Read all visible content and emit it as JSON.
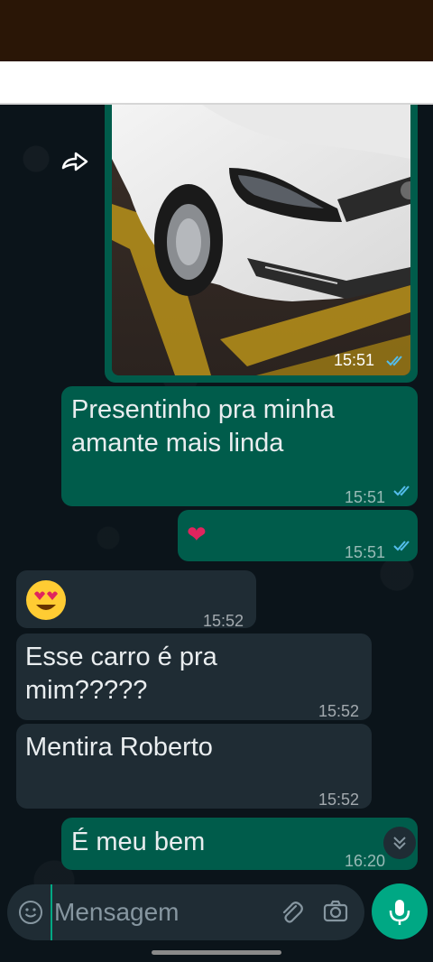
{
  "messages": [
    {
      "type": "image",
      "time": "15:51",
      "status": "read",
      "image": "white-car-photo"
    },
    {
      "type": "text",
      "direction": "out",
      "text_line1": "Presentinho pra minha",
      "text_line2": "amante mais linda",
      "time": "15:51",
      "status": "read"
    },
    {
      "type": "emoji",
      "direction": "out",
      "emoji": "❤️",
      "time": "15:51",
      "status": "read"
    },
    {
      "type": "emoji",
      "direction": "in",
      "emoji": "😍",
      "time": "15:52"
    },
    {
      "type": "text",
      "direction": "in",
      "text_line1": "Esse carro é pra",
      "text_line2": "mim?????",
      "time": "15:52"
    },
    {
      "type": "text",
      "direction": "in",
      "text_line1": "Mentira Roberto",
      "time": "15:52"
    },
    {
      "type": "text",
      "direction": "out",
      "text_line1": "É meu bem",
      "time": "16:20"
    }
  ],
  "composer": {
    "placeholder": "Mensagem",
    "icons": [
      "emoji-icon",
      "attach-icon",
      "camera-icon",
      "mic-icon"
    ]
  },
  "colors": {
    "outgoing_bubble": "#005c4b",
    "incoming_bubble": "#1f2c34",
    "background": "#0b141a",
    "accent": "#00a884",
    "read_ticks": "#53bdeb",
    "top_bar": "#2a1606"
  }
}
